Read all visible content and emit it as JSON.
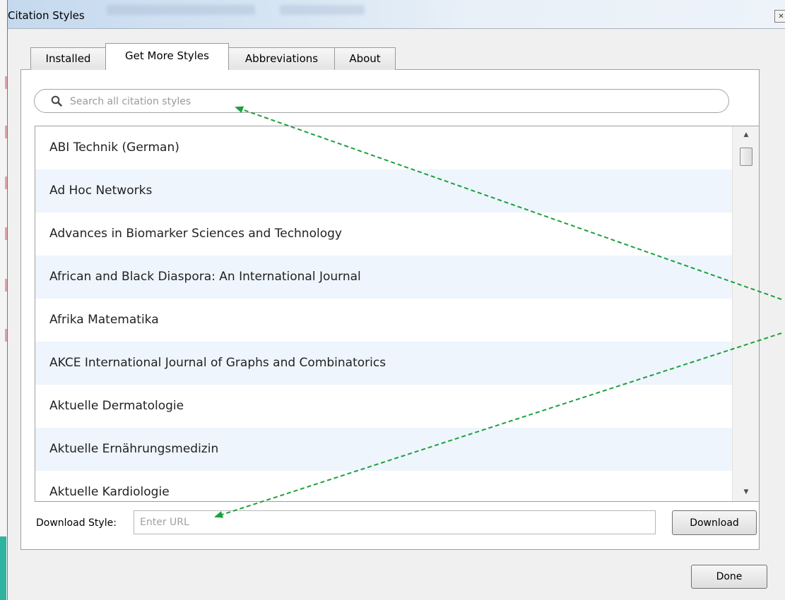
{
  "window": {
    "title": "Citation Styles",
    "close_symbol": "✕"
  },
  "tabs": [
    {
      "label": "Installed"
    },
    {
      "label": "Get More Styles"
    },
    {
      "label": "Abbreviations"
    },
    {
      "label": "About"
    }
  ],
  "search": {
    "placeholder": "Search all citation styles",
    "icon": "search-icon"
  },
  "styles": [
    {
      "name": "ABI Technik (German)"
    },
    {
      "name": "Ad Hoc Networks"
    },
    {
      "name": "Advances in Biomarker Sciences and Technology"
    },
    {
      "name": "African and Black Diaspora: An International Journal"
    },
    {
      "name": "Afrika Matematika"
    },
    {
      "name": "AKCE International Journal of Graphs and Combinatorics"
    },
    {
      "name": "Aktuelle Dermatologie"
    },
    {
      "name": "Aktuelle Ernährungsmedizin"
    },
    {
      "name": "Aktuelle Kardiologie"
    }
  ],
  "scrollbar": {
    "up_arrow": "▲",
    "down_arrow": "▼"
  },
  "download": {
    "label": "Download Style:",
    "placeholder": "Enter URL",
    "button_label": "Download"
  },
  "footer": {
    "done_label": "Done"
  },
  "colors": {
    "annotation_arrow": "#1aa13c",
    "row_alt": "#eef5fc"
  }
}
